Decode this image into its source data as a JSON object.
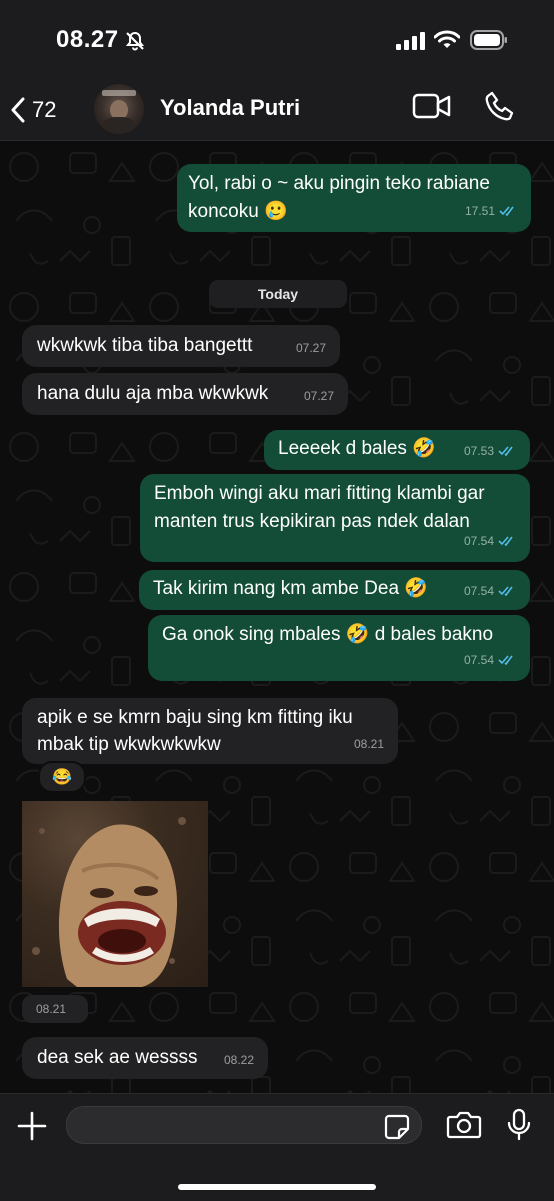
{
  "status_bar": {
    "time": "08.27",
    "icons": [
      "bell-slash-icon",
      "signal-icon",
      "wifi-icon",
      "battery-icon"
    ]
  },
  "header": {
    "back_count": "72",
    "contact_name": "Yolanda Putri"
  },
  "chat": {
    "date_label": "Today",
    "messages": [
      {
        "direction": "out",
        "lines": [
          "Yol, rabi o ~ aku pingin teko rabiane",
          "koncoku 🥲"
        ],
        "time": "17.51",
        "read": true
      },
      {
        "direction": "in",
        "lines": [
          "wkwkwk tiba tiba bangettt"
        ],
        "time": "07.27"
      },
      {
        "direction": "in",
        "lines": [
          "hana dulu aja mba wkwkwk"
        ],
        "time": "07.27"
      },
      {
        "direction": "out",
        "lines": [
          "Leeeek d bales 🤣"
        ],
        "time": "07.53",
        "read": true
      },
      {
        "direction": "out",
        "lines": [
          "Emboh wingi aku mari fitting klambi gar",
          "manten trus kepikiran pas ndek dalan"
        ],
        "time": "07.54",
        "read": true
      },
      {
        "direction": "out",
        "lines": [
          "Tak kirim nang km ambe Dea 🤣"
        ],
        "time": "07.54",
        "read": true
      },
      {
        "direction": "out",
        "lines": [
          "Ga onok sing mbales 🤣 d bales bakno"
        ],
        "time": "07.54",
        "read": true
      },
      {
        "direction": "in",
        "lines": [
          "apik e se kmrn baju sing km fitting iku",
          "mbak tip wkwkwkwkw"
        ],
        "time": "08.21",
        "reaction": "😂"
      },
      {
        "direction": "in",
        "type": "sticker",
        "time": "08.21"
      },
      {
        "direction": "in",
        "lines": [
          "dea sek ae wessss"
        ],
        "time": "08.22"
      }
    ]
  },
  "colors": {
    "outgoing_bubble": "#134d37",
    "incoming_bubble": "#222224",
    "read_ticks": "#53bdeb"
  }
}
